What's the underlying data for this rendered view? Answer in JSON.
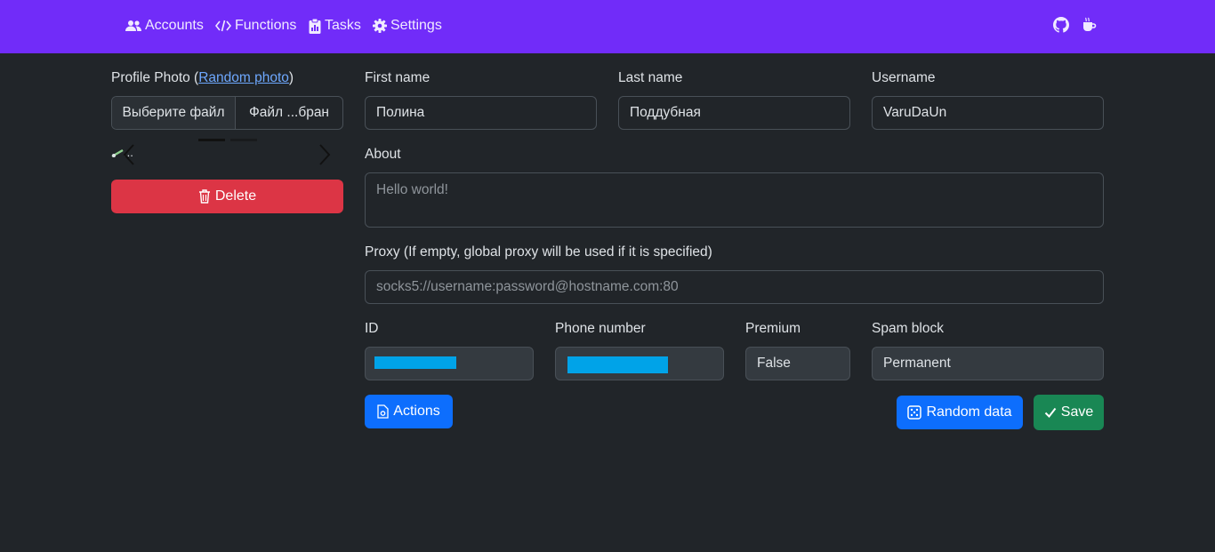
{
  "nav": {
    "accounts": "Accounts",
    "functions": "Functions",
    "tasks": "Tasks",
    "settings": "Settings",
    "github_icon": "github-icon",
    "coffee_icon": "coffee-icon"
  },
  "photo": {
    "label": "Profile Photo (",
    "random_link": "Random photo",
    "label_end": ")",
    "choose_file": "Выберите файл",
    "file_name": "Файл ...бран",
    "carousel_caption": "...",
    "delete": "Delete"
  },
  "form": {
    "first_name_label": "First name",
    "first_name_value": "Полина",
    "last_name_label": "Last name",
    "last_name_value": "Поддубная",
    "username_label": "Username",
    "username_value": "VaruDaUn",
    "about_label": "About",
    "about_placeholder": "Hello world!",
    "proxy_label": "Proxy (If empty, global proxy will be used if it is specified)",
    "proxy_placeholder": "socks5://username:password@hostname.com:80",
    "id_label": "ID",
    "phone_label": "Phone number",
    "premium_label": "Premium",
    "premium_value": "False",
    "spam_label": "Spam block",
    "spam_value": "Permanent"
  },
  "buttons": {
    "actions": "Actions",
    "random_data": "Random data",
    "save": "Save"
  },
  "colors": {
    "navbar": "#712cf9",
    "background": "#212529",
    "danger": "#dc3545",
    "primary": "#0d6efd",
    "success": "#198754",
    "redaction": "#00a3e8"
  }
}
